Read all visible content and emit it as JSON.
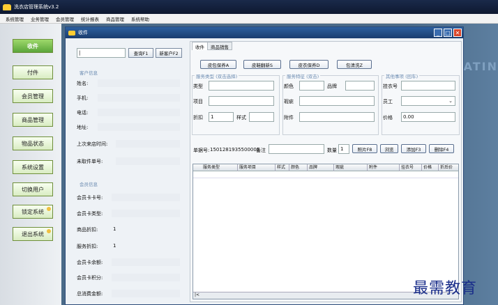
{
  "app": {
    "title": "洗衣店管理系统v3.2"
  },
  "menu": [
    "系统管理",
    "业务管理",
    "会员管理",
    "统计报表",
    "商品管理",
    "系统帮助"
  ],
  "nav": [
    "收件",
    "付件",
    "会员管理",
    "商品管理",
    "物品状态",
    "系统设置",
    "切换用户",
    "锁定系统",
    "退出系统"
  ],
  "window": {
    "title": "收件"
  },
  "customer": {
    "search_value": "|",
    "query_btn": "查询F1",
    "new_btn": "新客户F2",
    "group": "客户信息",
    "labels": [
      "姓名:",
      "手机:",
      "电话:",
      "地址:",
      "上次来店时间:",
      "未取件单号:"
    ]
  },
  "member": {
    "group": "会员信息",
    "labels": [
      "会员卡卡号:",
      "会员卡类型:",
      "商品折扣:",
      "服务折扣:",
      "会员卡余额:",
      "会员卡积分:",
      "总消费金额:"
    ],
    "goods_discount": "1",
    "service_discount": "1"
  },
  "tabs": [
    "收件",
    "商品销售"
  ],
  "ocr_buttons": [
    "皮包保养A",
    "皮鞋翻新S",
    "皮衣保养D",
    "包清洗Z"
  ],
  "groups": {
    "service": "服务类型 (双击选择)",
    "features": "服务特征 (双击)",
    "other": "其他事项 (回车)"
  },
  "service_labels": [
    "类型",
    "项目",
    "折扣",
    "样式"
  ],
  "discount_value": "1",
  "feature_labels": [
    "颜色",
    "品牌",
    "瑕疵",
    "附件"
  ],
  "other_labels": [
    "挂衣号",
    "员工",
    "价格"
  ],
  "price_value": "0.00",
  "order": {
    "label": "单据号:",
    "number": "1501281935500001",
    "remark_label": "备注",
    "qty_label": "数量",
    "qty_value": "1",
    "buttons": [
      "照片F8",
      "浏览",
      "添加F3",
      "删除F4"
    ]
  },
  "grid_columns": [
    "服务类型",
    "服务项目",
    "样式",
    "颜色",
    "品牌",
    "瑕疵",
    "附件",
    "挂衣号",
    "价格",
    "折后价"
  ],
  "watermark": "最需教育",
  "colors": {
    "accent": "#2d5f9e",
    "nav_green": "#5aa53a",
    "close": "#d9462a"
  }
}
